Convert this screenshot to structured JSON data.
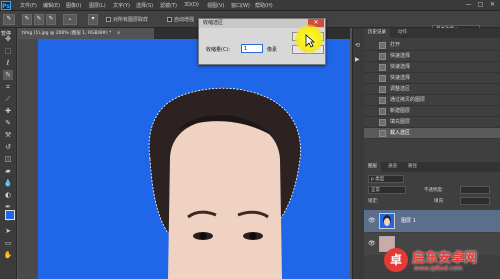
{
  "app": {
    "logo": "Ps"
  },
  "menubar": {
    "items": [
      "文件(F)",
      "编辑(E)",
      "图像(I)",
      "图层(L)",
      "文字(Y)",
      "选择(S)",
      "滤镜(T)",
      "3D(D)",
      "视图(V)",
      "窗口(W)",
      "帮助(H)"
    ],
    "win_controls": [
      "—",
      "□",
      "✕"
    ]
  },
  "options_bar": {
    "chk_all_layers": "对所有图层取样",
    "auto_enhance": "自动增强",
    "workspace": "基本功能"
  },
  "tab": {
    "label": "timg (1).jpg @ 200% (图层 1, RGB/8#) *",
    "close": "×"
  },
  "toolbox": {
    "label": "暂停"
  },
  "history_panel": {
    "tabs": [
      "历史记录",
      "动作"
    ],
    "items": [
      "打开",
      "快速选择",
      "快速选择",
      "快速选择",
      "调整选区",
      "通过拷贝的图层",
      "新建图层",
      "填充图层",
      "载入选区"
    ],
    "active_index": 8
  },
  "layers_panel": {
    "tabs": [
      "图层",
      "通道",
      "路径"
    ],
    "filter": "ρ 类型",
    "blend_mode": "正常",
    "opacity_label": "不透明度:",
    "lock_label": "锁定:",
    "fill_label": "填充:",
    "layer_name": "图层 1"
  },
  "dialog": {
    "title": "收缩选区",
    "field_label": "收缩量(C):",
    "field_value": "1",
    "unit": "像素",
    "ok": "确定",
    "cancel": "取消",
    "close": "✕"
  },
  "watermark": {
    "brand": "启东安卓网",
    "url": "www.qdtud.com"
  },
  "colors": {
    "canvas_bg": "#1f67e8",
    "accent": "#31a8ff",
    "highlight": "#f6ea1c",
    "watermark": "#e53935"
  }
}
